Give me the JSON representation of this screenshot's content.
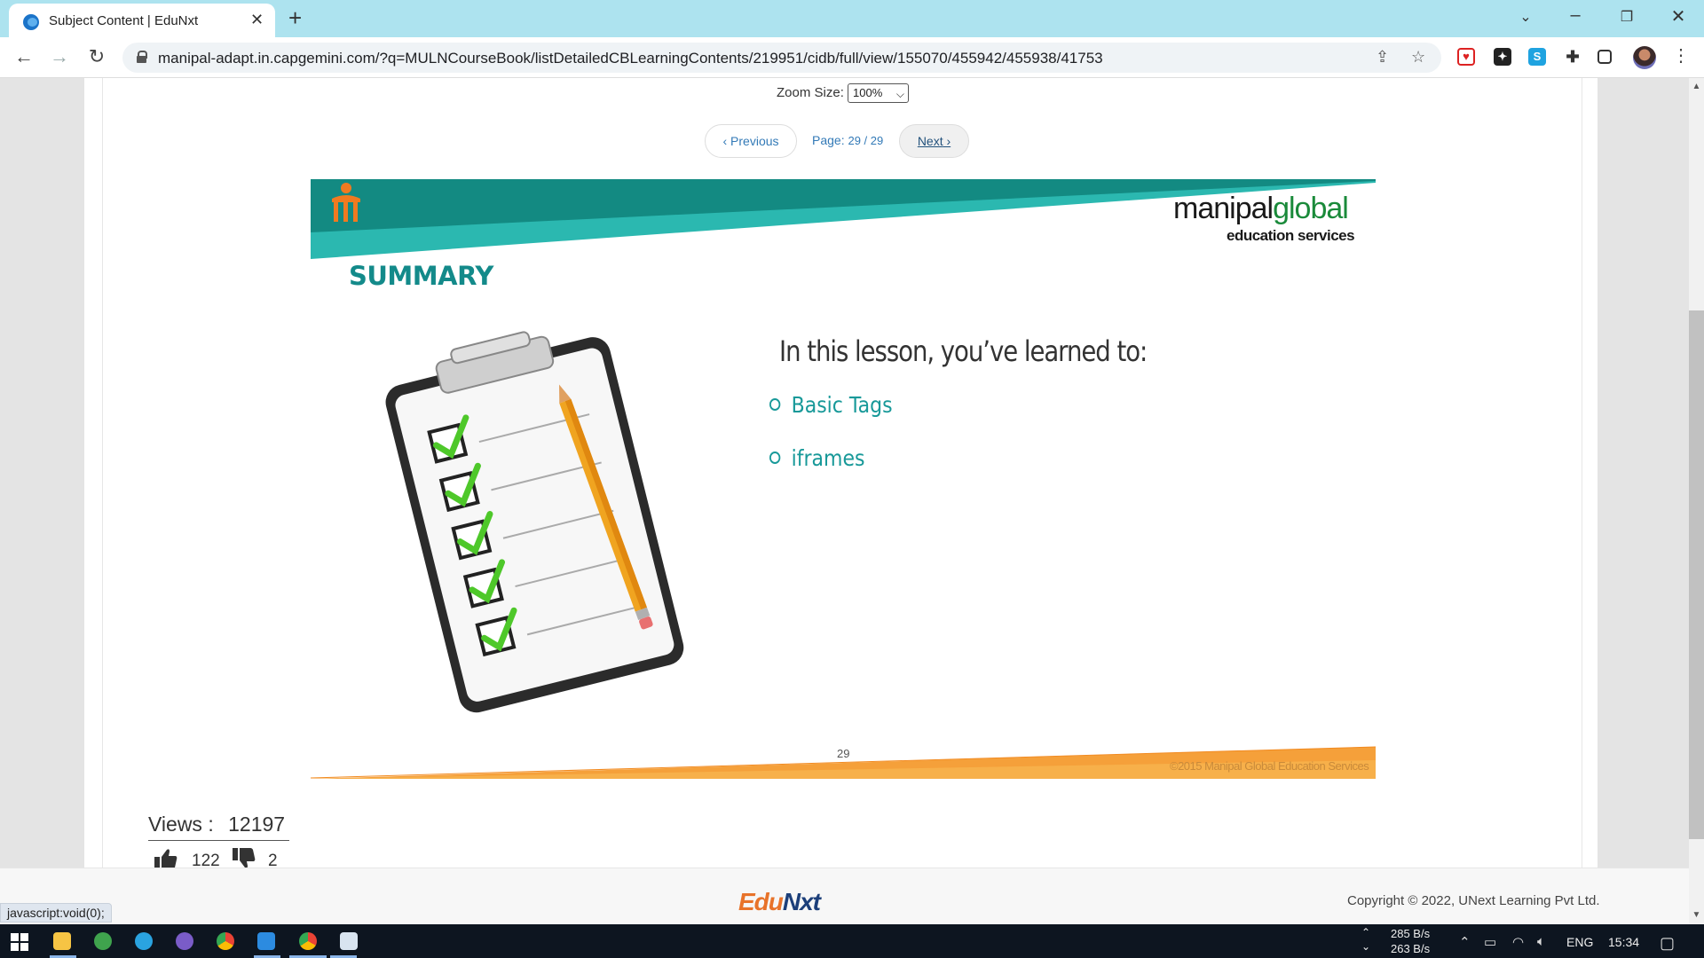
{
  "browser": {
    "tab_title": "Subject Content | EduNxt",
    "url": "manipal-adapt.in.capgemini.com/?q=MULNCourseBook/listDetailedCBLearningContents/219951/cidb/full/view/155070/455942/455938/41753"
  },
  "viewer": {
    "zoom_label": "Zoom Size:",
    "zoom_value": "100%",
    "prev_label": "Previous",
    "page_label": "Page:",
    "page_current": "29 / 29",
    "next_label": "Next"
  },
  "slide": {
    "logo_main_part1": "manipal",
    "logo_main_part2": "global",
    "logo_sub": "education services",
    "title": "SUMMARY",
    "heading": "In this lesson, you’ve learned to:",
    "bullets": [
      "Basic Tags",
      "iframes"
    ],
    "page_number": "29",
    "copyright": "©2015 Manipal Global Education Services"
  },
  "stats": {
    "views_label": "Views :",
    "views_count": "12197",
    "likes": "122",
    "dislikes": "2"
  },
  "footer": {
    "logo_part1": "Edu",
    "logo_part2": "Nxt",
    "copyright": "Copyright © 2022, UNext Learning Pvt Ltd.",
    "status_url": "javascript:void(0);"
  },
  "taskbar": {
    "net_up": "285 B/s",
    "net_down": "263 B/s",
    "language": "ENG",
    "time": "15:34"
  },
  "colors": {
    "teal": "#138a8a",
    "accent_orange": "#f5a03a",
    "link_blue": "#337ab7"
  }
}
